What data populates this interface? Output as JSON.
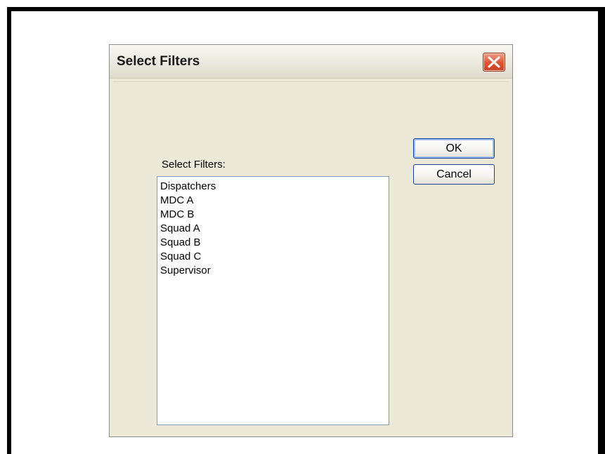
{
  "dialog": {
    "title": "Select Filters",
    "close_icon": "close-x-icon",
    "buttons": {
      "ok": "OK",
      "cancel": "Cancel"
    },
    "list_label": "Select Filters:",
    "list_items": [
      "Dispatchers",
      "MDC A",
      "MDC B",
      "Squad A",
      "Squad B",
      "Squad C",
      "Supervisor"
    ]
  },
  "colors": {
    "dialog_background": "#ece9d8",
    "close_button": "#dc5a3a",
    "button_border": "#1d3f8c",
    "listbox_border": "#7f9db9"
  }
}
